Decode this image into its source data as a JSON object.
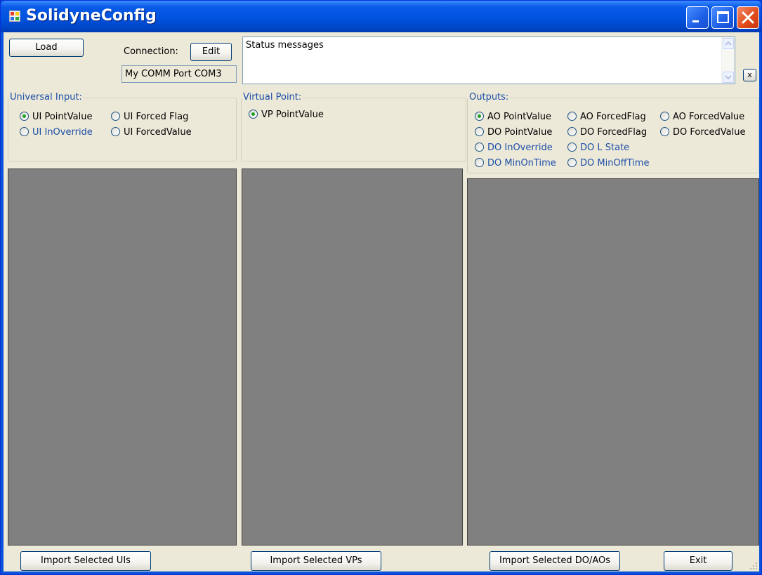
{
  "window": {
    "title": "SolidyneConfig"
  },
  "toolbar": {
    "load_label": "Load",
    "connection_label": "Connection:",
    "edit_label": "Edit",
    "port_value": "My COMM Port COM3",
    "status_text": "Status messages",
    "clear_label": "x"
  },
  "universal_input": {
    "caption": "Universal Input:",
    "options": [
      {
        "label": "UI PointValue",
        "selected": true,
        "style": "normal"
      },
      {
        "label": "UI Forced Flag",
        "selected": false,
        "style": "normal"
      },
      {
        "label": "UI InOverride",
        "selected": false,
        "style": "blue"
      },
      {
        "label": "UI ForcedValue",
        "selected": false,
        "style": "normal"
      }
    ]
  },
  "virtual_point": {
    "caption": "Virtual Point:",
    "options": [
      {
        "label": "VP PointValue",
        "selected": true,
        "style": "normal"
      }
    ]
  },
  "outputs": {
    "caption": "Outputs:",
    "options": [
      {
        "label": "AO PointValue",
        "selected": true,
        "style": "normal"
      },
      {
        "label": "AO ForcedFlag",
        "selected": false,
        "style": "normal"
      },
      {
        "label": "AO ForcedValue",
        "selected": false,
        "style": "normal"
      },
      {
        "label": "DO PointValue",
        "selected": false,
        "style": "normal"
      },
      {
        "label": "DO ForcedFlag",
        "selected": false,
        "style": "normal"
      },
      {
        "label": "DO ForcedValue",
        "selected": false,
        "style": "normal"
      },
      {
        "label": "DO InOverride",
        "selected": false,
        "style": "blue"
      },
      {
        "label": "DO L State",
        "selected": false,
        "style": "blue"
      },
      {
        "label": "DO MinOnTime",
        "selected": false,
        "style": "blue"
      },
      {
        "label": "DO MinOffTime",
        "selected": false,
        "style": "blue"
      }
    ]
  },
  "footer": {
    "import_uis": "Import Selected UIs",
    "import_vps": "Import Selected VPs",
    "import_outputs": "Import Selected DO/AOs",
    "exit": "Exit"
  },
  "colors": {
    "panel_bg": "#808080",
    "form_bg": "#ece9d8",
    "caption_blue": "#1c4ea8",
    "radio_selected": "#21a121"
  }
}
